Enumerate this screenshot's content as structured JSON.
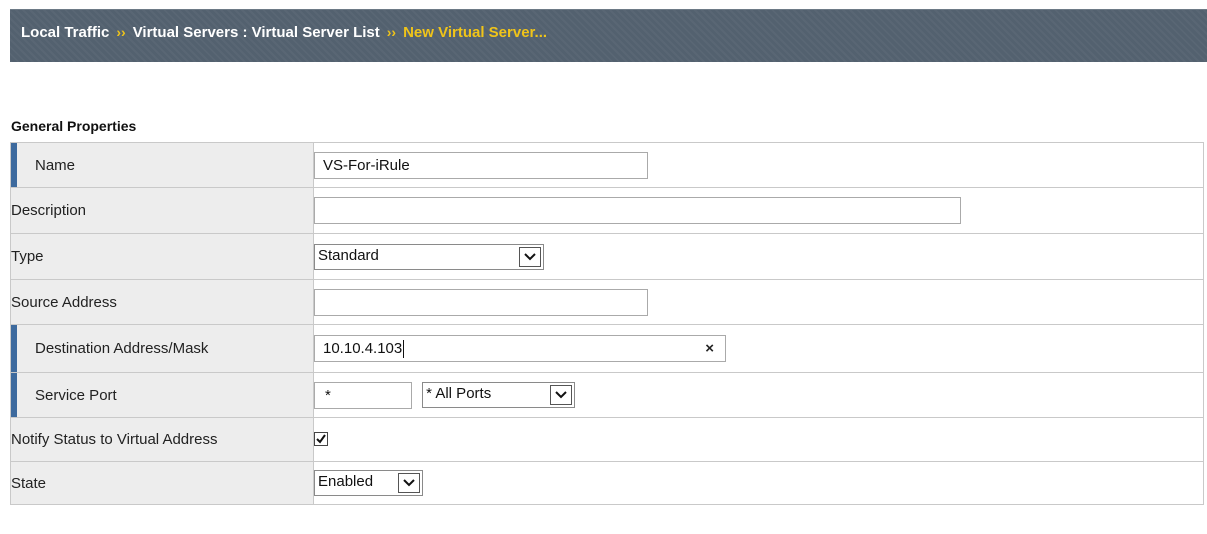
{
  "breadcrumb": {
    "items": [
      "Local Traffic",
      "Virtual Servers : Virtual Server List",
      "New Virtual Server..."
    ],
    "separator": "››"
  },
  "section_title": "General Properties",
  "fields": {
    "name": {
      "label": "Name",
      "value": "VS-For-iRule"
    },
    "description": {
      "label": "Description",
      "value": ""
    },
    "type": {
      "label": "Type",
      "selected": "Standard"
    },
    "source_address": {
      "label": "Source Address",
      "value": ""
    },
    "destination": {
      "label": "Destination Address/Mask",
      "value": "10.10.4.103",
      "clear_glyph": "×"
    },
    "service_port": {
      "label": "Service Port",
      "value": "*",
      "selected": "* All Ports"
    },
    "notify": {
      "label": "Notify Status to Virtual Address",
      "checked": true
    },
    "state": {
      "label": "State",
      "selected": "Enabled"
    }
  },
  "colors": {
    "header_bg": "#53616f",
    "breadcrumb_current": "#f0c419",
    "required_marker": "#3d6a9e",
    "label_bg": "#ededed"
  }
}
